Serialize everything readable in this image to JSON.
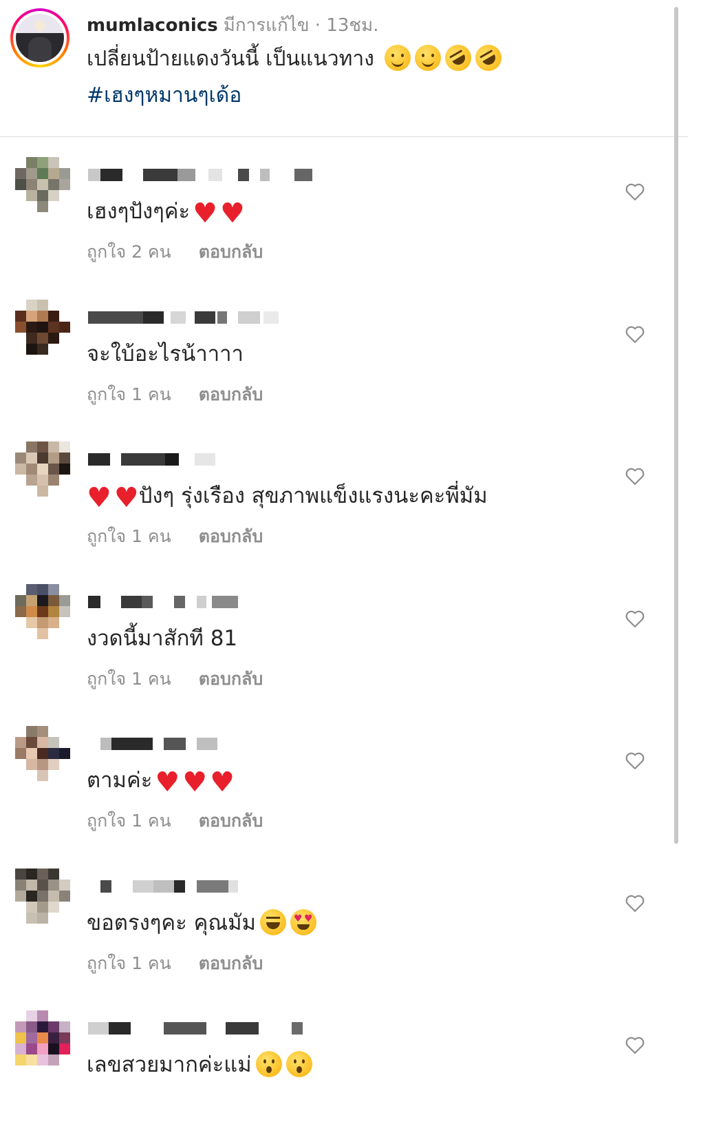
{
  "caption": {
    "username": "mumlaconics",
    "meta": "มีการแก้ไข · 13ชม.",
    "text": "เปลี่ยนป้ายแดงวันนี้ เป็นแนวทาง",
    "text_emojis": [
      "smiling-face",
      "smiling-face",
      "rolling-laughing",
      "rolling-laughing"
    ],
    "hashtag": "#เฮงๆหมานๆเด้อ"
  },
  "comments": [
    {
      "text": "เฮงๆปังๆค่ะ",
      "likes": "ถูกใจ 2 คน",
      "reply": "ตอบกลับ"
    },
    {
      "text": "จะใบ้อะไรน้าาาา",
      "likes": "ถูกใจ 1 คน",
      "reply": "ตอบกลับ"
    },
    {
      "text": "ปังๆ รุ่งเรือง สุขภาพแข็งแรงนะคะพี่มัม",
      "likes": "ถูกใจ 1 คน",
      "reply": "ตอบกลับ"
    },
    {
      "text": "งวดนี้มาสักที 81",
      "likes": "ถูกใจ 1 คน",
      "reply": "ตอบกลับ"
    },
    {
      "text": "ตามค่ะ",
      "likes": "ถูกใจ 1 คน",
      "reply": "ตอบกลับ"
    },
    {
      "text": "ขอตรงๆคะ คุณมัม",
      "likes": "ถูกใจ 1 คน",
      "reply": "ตอบกลับ"
    },
    {
      "text": "เลขสวยมากค่ะแม่",
      "likes": "",
      "reply": ""
    }
  ],
  "icons": {
    "like": "heart-outline-icon",
    "emoji_heart": "red-heart"
  },
  "colors": {
    "text": "#262626",
    "muted": "#8e8e8e",
    "hashtag": "#00376b",
    "heart": "#e8202c",
    "divider": "#dbdbdb"
  }
}
